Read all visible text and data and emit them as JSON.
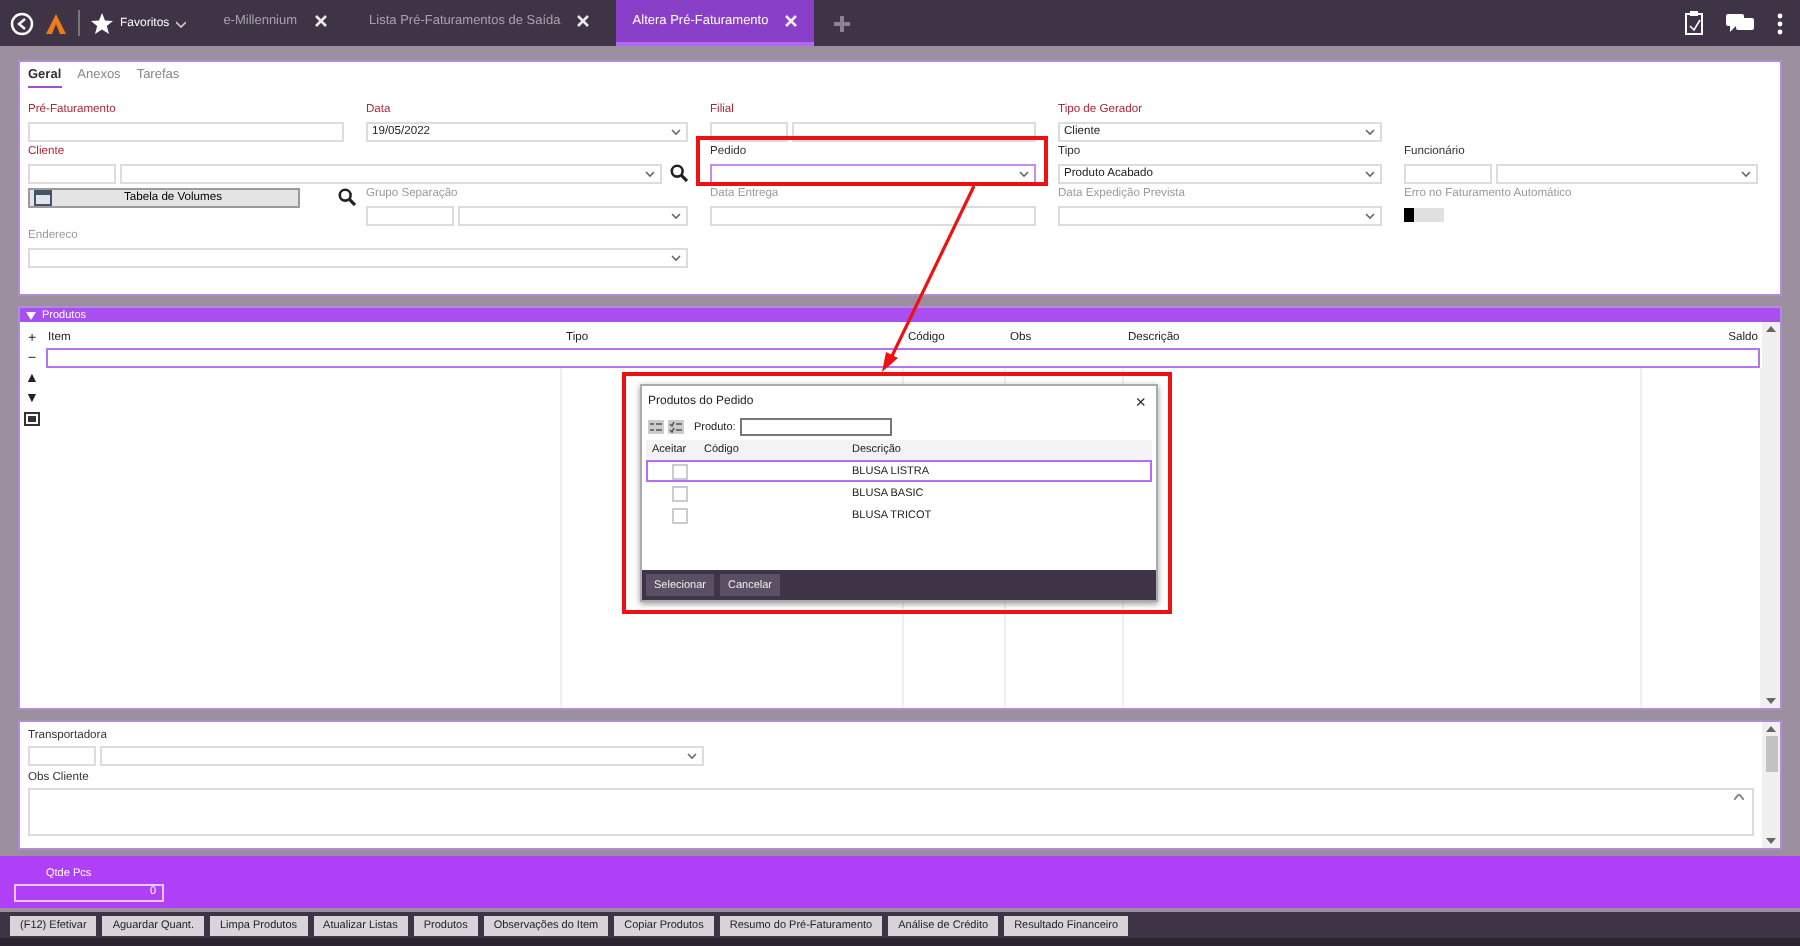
{
  "top_bar": {
    "favorites": "Favoritos",
    "tabs": [
      {
        "label": "e-Millennium",
        "selected": false
      },
      {
        "label": "Lista Pré-Faturamentos de Saída",
        "selected": false
      },
      {
        "label": "Altera Pré-Faturamento",
        "selected": true
      }
    ]
  },
  "form_tabs": [
    {
      "label": "Geral",
      "selected": true
    },
    {
      "label": "Anexos",
      "selected": false
    },
    {
      "label": "Tarefas",
      "selected": false
    }
  ],
  "fields": [
    {
      "label": "Pré-Faturamento",
      "kind": "text",
      "required": true,
      "disabled": false
    },
    {
      "label": "Data",
      "kind": "select",
      "value": "19/05/2022",
      "required": true,
      "disabled": false
    },
    {
      "label": "Filial",
      "kind": "pair",
      "required": true,
      "disabled": false
    },
    {
      "label": "Tipo de Gerador",
      "kind": "select",
      "value": "Cliente",
      "required": true,
      "disabled": false
    },
    {
      "label": "Cliente",
      "kind": "code-select",
      "required": true,
      "disabled": false,
      "search": true
    },
    {
      "label": "Pedido",
      "kind": "select",
      "required": false,
      "disabled": false,
      "focused": true
    },
    {
      "label": "Tipo",
      "kind": "select",
      "value": "Produto Acabado",
      "required": false,
      "disabled": false
    },
    {
      "label": "Funcionário",
      "kind": "code-select",
      "required": false,
      "disabled": false
    },
    {
      "label": "Tabela de Volumes",
      "kind": "button",
      "search": true
    },
    {
      "label": "Grupo Separação",
      "kind": "code-select",
      "required": false,
      "disabled": true
    },
    {
      "label": "Data Entrega",
      "kind": "text",
      "required": false,
      "disabled": true
    },
    {
      "label": "Data Expedição Prevista",
      "kind": "select",
      "required": false,
      "disabled": true
    },
    {
      "label": "Erro no Faturamento Automático",
      "kind": "toggle",
      "on": false,
      "required": false,
      "disabled": true
    },
    {
      "label": "Endereco",
      "kind": "select",
      "required": false,
      "disabled": true
    }
  ],
  "products": {
    "title": "Produtos",
    "tools": [
      "+",
      "−",
      "▲",
      "▼"
    ],
    "columns": [
      "Item",
      "Tipo",
      "Código",
      "Obs",
      "Descrição",
      "Saldo"
    ],
    "rows": [
      {
        "selected": true
      }
    ]
  },
  "dialog": {
    "title": "Produtos do Pedido",
    "close": "×",
    "filter_label": "Produto:",
    "columns": [
      "Aceitar",
      "Código",
      "Descrição"
    ],
    "rows": [
      {
        "description": "BLUSA LISTRA",
        "checked": false,
        "selected": true
      },
      {
        "description": "BLUSA BASIC",
        "checked": false,
        "selected": false
      },
      {
        "description": "BLUSA TRICOT",
        "checked": false,
        "selected": false
      }
    ],
    "buttons": [
      "Selecionar",
      "Cancelar"
    ]
  },
  "lower_fields": [
    {
      "label": "Transportadora",
      "kind": "code-select"
    },
    {
      "label": "Obs Cliente",
      "kind": "textarea"
    }
  ],
  "summary": {
    "label": "Qtde Pcs",
    "value": "0"
  },
  "actions": [
    "(F12) Efetivar",
    "Aguardar Quant.",
    "Limpa Produtos",
    "Atualizar Listas",
    "Produtos",
    "Observações do Item",
    "Copiar Produtos",
    "Resumo do Pré-Faturamento",
    "Análise de Crédito",
    "Resultado Financeiro"
  ]
}
